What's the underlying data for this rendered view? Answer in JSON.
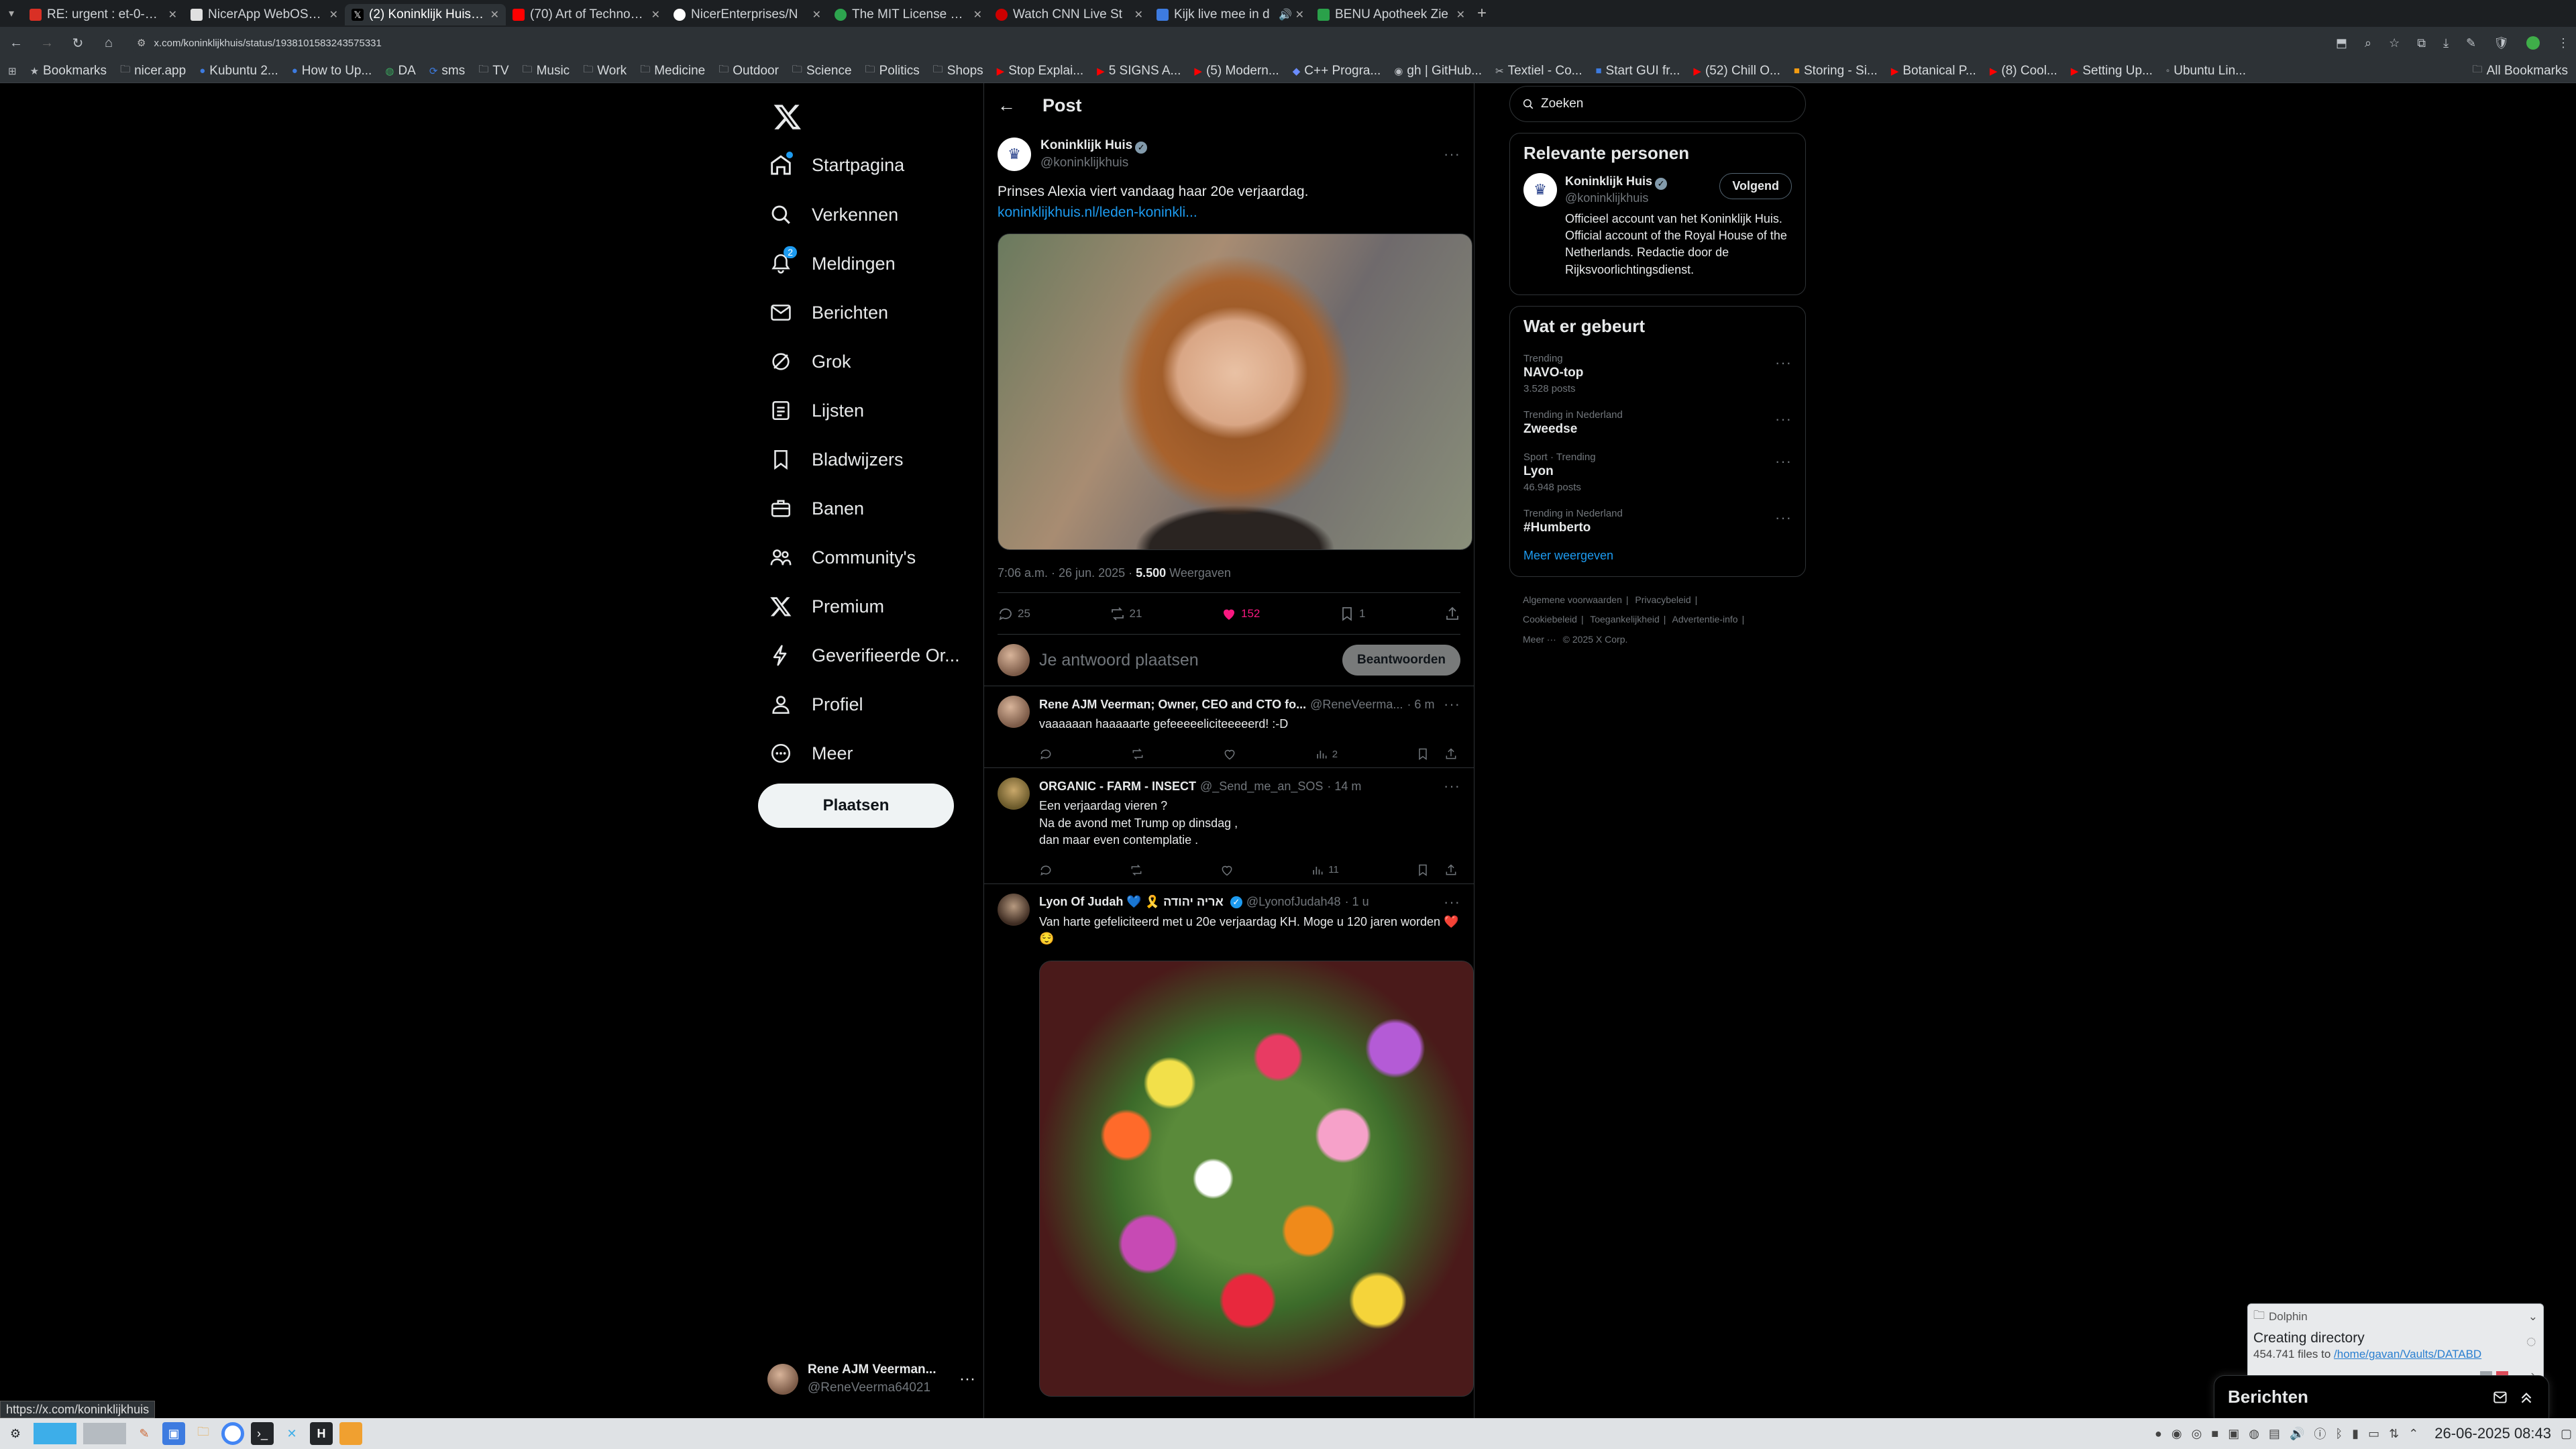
{
  "browser": {
    "tabs": [
      {
        "title": "RE: urgent : et-0-0-1",
        "icon_color": "#d93025"
      },
      {
        "title": "NicerApp WebOS hosting",
        "icon_color": "#e0e0e0"
      },
      {
        "title": "(2) Koninklijk Huis op X",
        "icon_color": "#000000",
        "active": true
      },
      {
        "title": "(70) Art of Technology",
        "icon_color": "#ff0000"
      },
      {
        "title": "NicerEnterprises/N",
        "icon_color": "#ffffff"
      },
      {
        "title": "The MIT License – C",
        "icon_color": "#2da44e"
      },
      {
        "title": "Watch CNN Live St",
        "icon_color": "#cc0000"
      },
      {
        "title": "Kijk live mee in d",
        "icon_color": "#3d7be0"
      },
      {
        "title": "BENU Apotheek Zie",
        "icon_color": "#2aa14a"
      }
    ],
    "url": "x.com/koninklijkhuis/status/1938101583243575331",
    "bookmarks": [
      "Bookmarks",
      "nicer.app",
      "Kubuntu 2...",
      "How to Up...",
      "DA",
      "sms",
      "TV",
      "Music",
      "Work",
      "Medicine",
      "Outdoor",
      "Science",
      "Politics",
      "Shops",
      "Stop Explai...",
      "5 SIGNS A...",
      "(5) Modern...",
      "C++ Progra...",
      "gh | GitHub...",
      "Textiel - Co...",
      "Start GUI fr...",
      "(52) Chill O...",
      "Storing - Si...",
      "Botanical P...",
      "(8) Cool...",
      "Setting Up...",
      "Ubuntu Lin..."
    ],
    "all_bookmarks": "All Bookmarks",
    "status_url": "https://x.com/koninklijkhuis"
  },
  "nav": {
    "items": [
      {
        "label": "Startpagina",
        "icon": "home-icon"
      },
      {
        "label": "Verkennen",
        "icon": "search-icon"
      },
      {
        "label": "Meldingen",
        "icon": "bell-icon",
        "badge": "2"
      },
      {
        "label": "Berichten",
        "icon": "mail-icon"
      },
      {
        "label": "Grok",
        "icon": "grok-icon"
      },
      {
        "label": "Lijsten",
        "icon": "list-icon"
      },
      {
        "label": "Bladwijzers",
        "icon": "bookmark-icon"
      },
      {
        "label": "Banen",
        "icon": "briefcase-icon"
      },
      {
        "label": "Community's",
        "icon": "community-icon"
      },
      {
        "label": "Premium",
        "icon": "x-icon"
      },
      {
        "label": "Geverifieerde Or...",
        "icon": "lightning-icon"
      },
      {
        "label": "Profiel",
        "icon": "person-icon"
      },
      {
        "label": "Meer",
        "icon": "more-circle-icon"
      }
    ],
    "post_button": "Plaatsen",
    "account": {
      "name": "Rene AJM Veerman...",
      "handle": "@ReneVeerma64021"
    }
  },
  "main": {
    "header": "Post",
    "post": {
      "author": "Koninklijk Huis",
      "handle": "@koninklijkhuis",
      "text": "Prinses Alexia viert vandaag haar 20e verjaardag.",
      "link": "koninklijkhuis.nl/leden-koninkli...",
      "time": "7:06 a.m. · 26 jun. 2025 · ",
      "views_count": "5.500",
      "views_label": " Weergaven",
      "replies": "25",
      "reposts": "21",
      "likes": "152",
      "bookmarks": "1"
    },
    "reply_placeholder": "Je antwoord plaatsen",
    "reply_button": "Beantwoorden",
    "replies": [
      {
        "name": "Rene AJM Veerman; Owner, CEO and CTO fo...",
        "handle": "@ReneVeerma...",
        "time": "· 6 m",
        "text": "vaaaaaan haaaaarte gefeeeeeliciteeeeerd! :-D",
        "views": "2"
      },
      {
        "name": "ORGANIC - FARM - INSECT",
        "handle": "@_Send_me_an_SOS",
        "time": "· 14 m",
        "text": "Een verjaardag vieren ?\nNa de avond met Trump op dinsdag ,\ndan maar even contemplatie .",
        "views": "11"
      },
      {
        "name": "Lyon Of Judah 💙 🎗️ אריה יהודה",
        "handle": "@LyonofJudah48",
        "time": "· 1 u",
        "text": "Van harte gefeliciteerd met u 20e verjaardag KH. Moge u 120 jaren worden ❤️😌"
      }
    ]
  },
  "right": {
    "search_placeholder": "Zoeken",
    "relevant_title": "Relevante personen",
    "relevant": {
      "name": "Koninklijk Huis",
      "handle": "@koninklijkhuis",
      "follow": "Volgend",
      "bio": "Officieel account van het Koninklijk Huis. Official account of the Royal House of the Netherlands. Redactie door de Rijksvoorlichtingsdienst."
    },
    "trends_title": "Wat er gebeurt",
    "trends": [
      {
        "context": "Trending",
        "title": "NAVO-top",
        "count": "3.528 posts"
      },
      {
        "context": "Trending in Nederland",
        "title": "Zweedse",
        "count": ""
      },
      {
        "context": "Sport · Trending",
        "title": "Lyon",
        "count": "46.948 posts"
      },
      {
        "context": "Trending in Nederland",
        "title": "#Humberto",
        "count": ""
      }
    ],
    "show_more": "Meer weergeven",
    "footer": [
      "Algemene voorwaarden",
      "|",
      "Privacybeleid",
      "|",
      "Cookiebeleid",
      "|",
      "Toegankelijkheid",
      "|",
      "Advertentie-info",
      "|",
      "Meer ···",
      "© 2025 X Corp."
    ]
  },
  "dolphin": {
    "app": "Dolphin",
    "title": "Creating directory",
    "subtitle_prefix": "454.741 files to ",
    "path": "/home/gavan/Vaults/DATABD"
  },
  "messages_drawer": "Berichten",
  "taskbar": {
    "clock": "26-06-2025  08:43"
  }
}
